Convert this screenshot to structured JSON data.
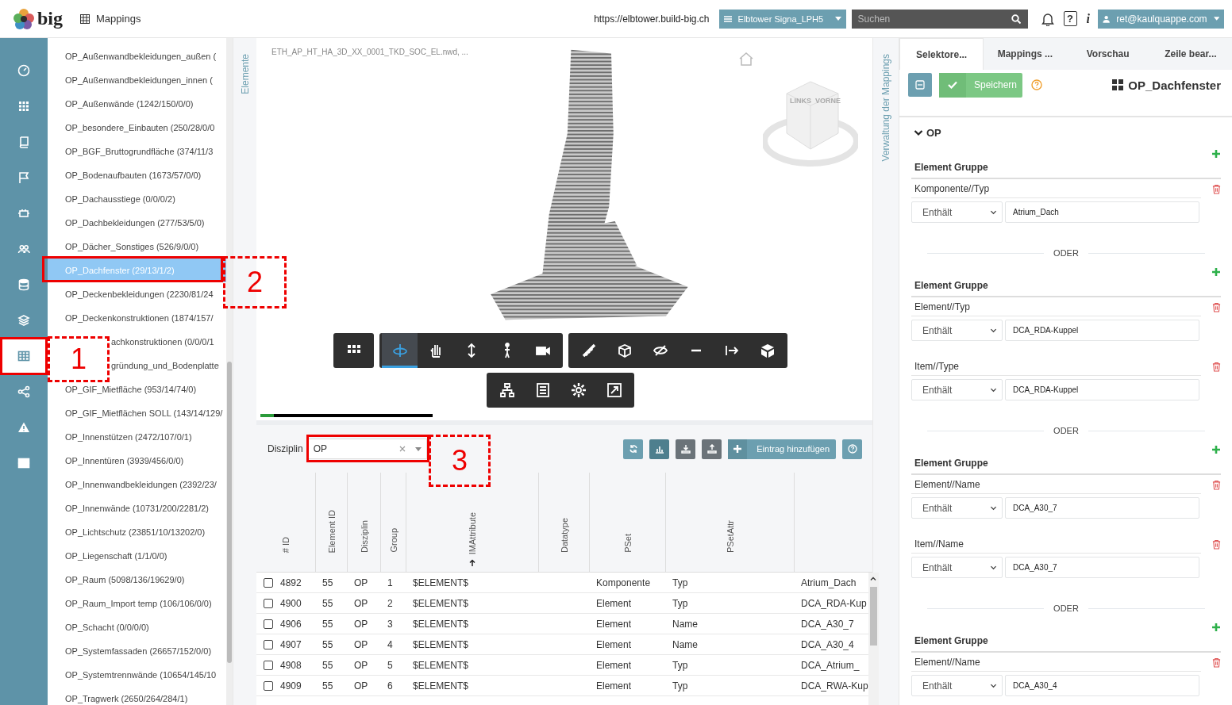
{
  "header": {
    "logo": "big",
    "page_title": "Mappings",
    "url": "https://elbtower.build-big.ch",
    "project": "Elbtower Signa_LPH5",
    "search": {
      "placeholder": "Suchen"
    },
    "help_label": "?",
    "info_label": "i",
    "user": "ret@kaulquappe.com"
  },
  "nav_items": [
    {
      "selected": false
    },
    {
      "selected": false
    },
    {
      "selected": false
    },
    {
      "selected": false
    },
    {
      "selected": false
    },
    {
      "selected": false
    },
    {
      "selected": false
    },
    {
      "selected": false
    },
    {
      "selected": true
    },
    {
      "selected": false
    },
    {
      "selected": false
    },
    {
      "selected": false
    }
  ],
  "element_list": {
    "items": [
      {
        "label": "OP_Außenwandbekleidungen_außen (",
        "selected": false,
        "covered": false
      },
      {
        "label": "OP_Außenwandbekleidungen_innen (",
        "selected": false,
        "covered": false
      },
      {
        "label": "OP_Außenwände (1242/150/0/0)",
        "selected": false,
        "covered": false
      },
      {
        "label": "OP_besondere_Einbauten (250/28/0/0",
        "selected": false,
        "covered": false
      },
      {
        "label": "OP_BGF_Bruttogrundfläche (374/11/3",
        "selected": false,
        "covered": false
      },
      {
        "label": "OP_Bodenaufbauten (1673/57/0/0)",
        "selected": false,
        "covered": false
      },
      {
        "label": "OP_Dachausstiege (0/0/0/2)",
        "selected": false,
        "covered": false
      },
      {
        "label": "OP_Dachbekleidungen (277/53/5/0)",
        "selected": false,
        "covered": false
      },
      {
        "label": "OP_Dächer_Sonstiges (526/9/0/0)",
        "selected": false,
        "covered": false
      },
      {
        "label": "OP_Dachfenster (29/13/1/2)",
        "selected": true,
        "covered": false
      },
      {
        "label": "OP_Deckenbekleidungen (2230/81/24",
        "selected": false,
        "covered": false
      },
      {
        "label": "OP_Deckenkonstruktionen (1874/157/",
        "selected": false,
        "covered": false
      },
      {
        "label": "achkonstruktionen (0/0/0/1",
        "selected": false,
        "covered": true
      },
      {
        "label": "gründung_und_Bodenplatte",
        "selected": false,
        "covered": true
      },
      {
        "label": "OP_GIF_Mietfläche (953/14/74/0)",
        "selected": false,
        "covered": false
      },
      {
        "label": "OP_GIF_Mietflächen SOLL (143/14/129/",
        "selected": false,
        "covered": false
      },
      {
        "label": "OP_Innenstützen (2472/107/0/1)",
        "selected": false,
        "covered": false
      },
      {
        "label": "OP_Innentüren (3939/456/0/0)",
        "selected": false,
        "covered": false
      },
      {
        "label": "OP_Innenwandbekleidungen (2392/23/",
        "selected": false,
        "covered": false
      },
      {
        "label": "OP_Innenwände (10731/200/2281/2)",
        "selected": false,
        "covered": false
      },
      {
        "label": "OP_Lichtschutz (23851/10/13202/0)",
        "selected": false,
        "covered": false
      },
      {
        "label": "OP_Liegenschaft (1/1/0/0)",
        "selected": false,
        "covered": false
      },
      {
        "label": "OP_Raum (5098/136/19629/0)",
        "selected": false,
        "covered": false
      },
      {
        "label": "OP_Raum_Import temp (106/106/0/0)",
        "selected": false,
        "covered": false
      },
      {
        "label": "OP_Schacht (0/0/0/0)",
        "selected": false,
        "covered": false
      },
      {
        "label": "OP_Systemfassaden (26657/152/0/0)",
        "selected": false,
        "covered": false
      },
      {
        "label": "OP_Systemtrennwände (10654/145/10",
        "selected": false,
        "covered": false
      },
      {
        "label": "OP_Tragwerk (2650/264/284/1)",
        "selected": false,
        "covered": false
      }
    ]
  },
  "elements_tab": "Elemente",
  "viewer": {
    "file_name": "ETH_AP_HT_HA_3D_XX_0001_TKD_SOC_EL.nwd, ...",
    "view_cube": [
      "LINKS",
      "VORNE"
    ],
    "toolbar_rows": [
      [
        {
          "tools": [
            {
              "selected": false
            }
          ]
        },
        {
          "tools": [
            {
              "selected": true
            },
            {
              "selected": false
            },
            {
              "selected": false
            },
            {
              "selected": false
            },
            {
              "selected": false
            }
          ]
        },
        {
          "tools": [
            {
              "selected": false
            },
            {
              "selected": false
            },
            {
              "selected": false
            },
            {
              "selected": false
            },
            {
              "selected": false
            },
            {
              "selected": false
            }
          ]
        }
      ],
      [
        {
          "tools": [
            {
              "selected": false
            },
            {
              "selected": false
            },
            {
              "selected": false
            },
            {
              "selected": false
            }
          ]
        }
      ]
    ],
    "load_progress": {
      "level": 0.08
    }
  },
  "filter": {
    "label": "Disziplin",
    "value": "OP"
  },
  "table_actions": {
    "add_label": "Eintrag hinzufügen"
  },
  "table": {
    "columns": [
      {
        "label": "# ID",
        "sorted": false
      },
      {
        "label": "Element ID",
        "sorted": false
      },
      {
        "label": "Disziplin",
        "sorted": false
      },
      {
        "label": "Group",
        "sorted": false
      },
      {
        "label": "IMAttribute",
        "sorted": true
      },
      {
        "label": "Datatype",
        "sorted": false
      },
      {
        "label": "PSet",
        "sorted": false
      },
      {
        "label": "PSetAttr",
        "sorted": false
      },
      {
        "sorted": false
      }
    ],
    "rows": [
      {
        "checked": false,
        "cells": [
          "4892",
          "55",
          "OP",
          "1",
          "$ELEMENT$",
          "",
          "Komponente",
          "Typ",
          "Atrium_Dach"
        ]
      },
      {
        "checked": false,
        "cells": [
          "4900",
          "55",
          "OP",
          "2",
          "$ELEMENT$",
          "",
          "Element",
          "Typ",
          "DCA_RDA-Kup"
        ]
      },
      {
        "checked": false,
        "cells": [
          "4906",
          "55",
          "OP",
          "3",
          "$ELEMENT$",
          "",
          "Element",
          "Name",
          "DCA_A30_7"
        ]
      },
      {
        "checked": false,
        "cells": [
          "4907",
          "55",
          "OP",
          "4",
          "$ELEMENT$",
          "",
          "Element",
          "Name",
          "DCA_A30_4"
        ]
      },
      {
        "checked": false,
        "cells": [
          "4908",
          "55",
          "OP",
          "5",
          "$ELEMENT$",
          "",
          "Element",
          "Typ",
          "DCA_Atrium_"
        ]
      },
      {
        "checked": false,
        "cells": [
          "4909",
          "55",
          "OP",
          "6",
          "$ELEMENT$",
          "",
          "Element",
          "Typ",
          "DCA_RWA-Kup"
        ]
      }
    ]
  },
  "mappings_tab": "Verwaltung der Mappings",
  "right_panel": {
    "tabs": [
      {
        "label": "Selektore...",
        "selected": true
      },
      {
        "label": "Mappings ...",
        "selected": false
      },
      {
        "label": "Vorschau",
        "selected": false
      },
      {
        "label": "Zeile bear...",
        "selected": false
      }
    ],
    "save_label": "Speichern",
    "title": "OP_Dachfenster",
    "section": {
      "label": "OP",
      "expanded": true
    },
    "groups": [
      {
        "title": "Element Gruppe",
        "conditions": [
          {
            "attribute": "Komponente//Typ",
            "operator": "Enthält",
            "value": "Atrium_Dach"
          }
        ]
      },
      {
        "separator": "ODER",
        "title": "Element Gruppe",
        "conditions": [
          {
            "attribute": "Element//Typ",
            "operator": "Enthält",
            "value": "DCA_RDA-Kuppel"
          },
          {
            "attribute": "Item//Type",
            "operator": "Enthält",
            "value": "DCA_RDA-Kuppel"
          }
        ]
      },
      {
        "separator": "ODER",
        "title": "Element Gruppe",
        "conditions": [
          {
            "attribute": "Element//Name",
            "operator": "Enthält",
            "value": "DCA_A30_7"
          },
          {
            "attribute": "Item//Name",
            "operator": "Enthält",
            "value": "DCA_A30_7"
          }
        ]
      },
      {
        "separator": "ODER",
        "title": "Element Gruppe",
        "conditions": [
          {
            "attribute": "Element//Name",
            "operator": "Enthält",
            "value": "DCA_A30_4"
          }
        ]
      }
    ]
  },
  "annotations": [
    {
      "kind": "outline"
    },
    {
      "kind": "outline"
    },
    {
      "kind": "outline"
    },
    {
      "kind": "callout",
      "label": "1"
    },
    {
      "kind": "callout",
      "label": "2"
    },
    {
      "kind": "callout",
      "label": "3"
    }
  ]
}
